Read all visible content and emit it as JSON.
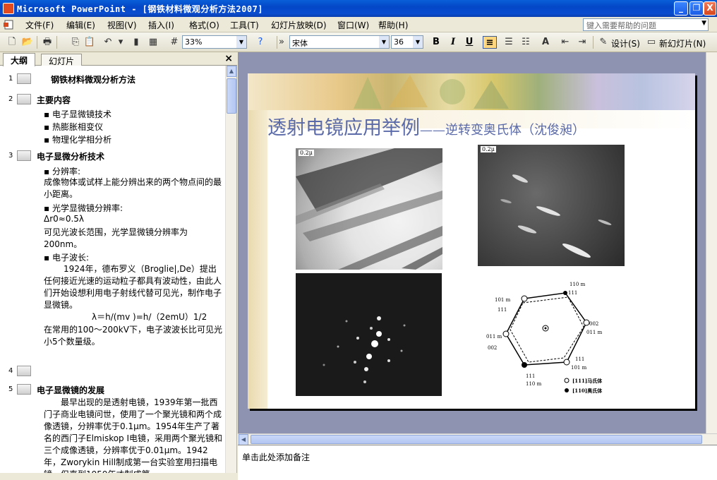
{
  "window": {
    "title": "Microsoft PowerPoint - [钢铁材料微观分析方法2007]",
    "min_label": "_",
    "max_label": "❐",
    "close_label": "X"
  },
  "menubar": {
    "items": [
      "文件(F)",
      "编辑(E)",
      "视图(V)",
      "插入(I)",
      "格式(O)",
      "工具(T)",
      "幻灯片放映(D)",
      "窗口(W)",
      "帮助(H)"
    ],
    "help_placeholder": "键入需要帮助的问题"
  },
  "toolbar": {
    "zoom": "33%",
    "font": "宋体",
    "font_size": "36",
    "bold": "B",
    "italic": "I",
    "underline": "U",
    "design_label": "设计(S)",
    "new_slide_label": "新幻灯片(N)"
  },
  "pane": {
    "tabs": [
      "大纲",
      "幻灯片"
    ],
    "close": "×"
  },
  "outline": {
    "s1_num": "1",
    "s1_title": "钢铁材料微观分析方法",
    "s2_num": "2",
    "s2_title": "主要内容",
    "s2_b1": "▪ 电子显微镜技术",
    "s2_b2": "▪ 热膨胀相变仪",
    "s2_b3": "▪ 物理化学相分析",
    "s3_num": "3",
    "s3_title": "电子显微分析技术",
    "s3_b1": "▪ 分辨率:",
    "s3_p1": "成像物体或试样上能分辨出来的两个物点间的最小距离。",
    "s3_b2": "▪ 光学显微镜分辨率:",
    "s3_p2": "Δr0≈0.5λ",
    "s3_p3": "可见光波长范围，光学显微镜分辨率为200nm。",
    "s3_b3": "▪ 电子波长:",
    "s3_p4": "1924年，德布罗义（Broglie|,De）提出任何接近光速的运动粒子都具有波动性，由此人们开始设想利用电子射线代替可见光，制作电子显微镜。",
    "s3_p5": "λ＝h/(mv )=h/（2emU）1/2",
    "s3_p6": "在常用的100～200kV下，电子波波长比可见光小5个数量级。",
    "s4_num": "4",
    "s5_num": "5",
    "s5_title": "电子显微镜的发展",
    "s5_p1": "最早出现的是透射电镜，1939年第一批西门子商业电镜问世，使用了一个聚光镜和两个成像透镜，分辨率优于0.1μm。1954年生产了著名的西门子Elmiskop I电镜，采用两个聚光镜和三个成像透镜，分辨率优于0.01μm。1942年，Zworykin Hill制成第一台实验室用扫描电镜，但直到1959年才制成第"
  },
  "slide": {
    "title_main": "透射电镜应用举例",
    "title_sub": "——逆转变奥氏体（沈俊昶）",
    "scale1": "0.2μ",
    "scale2": "0.2μ",
    "legend1": "[111]马氏体",
    "legend2": "[110]奥氏体",
    "diag_labels": [
      "110 m",
      "111",
      "101 m",
      "111",
      "002",
      "011 m",
      "011 m",
      "002",
      "111",
      "101 m",
      "111",
      "110 m"
    ]
  },
  "notes": {
    "placeholder": "单击此处添加备注"
  }
}
